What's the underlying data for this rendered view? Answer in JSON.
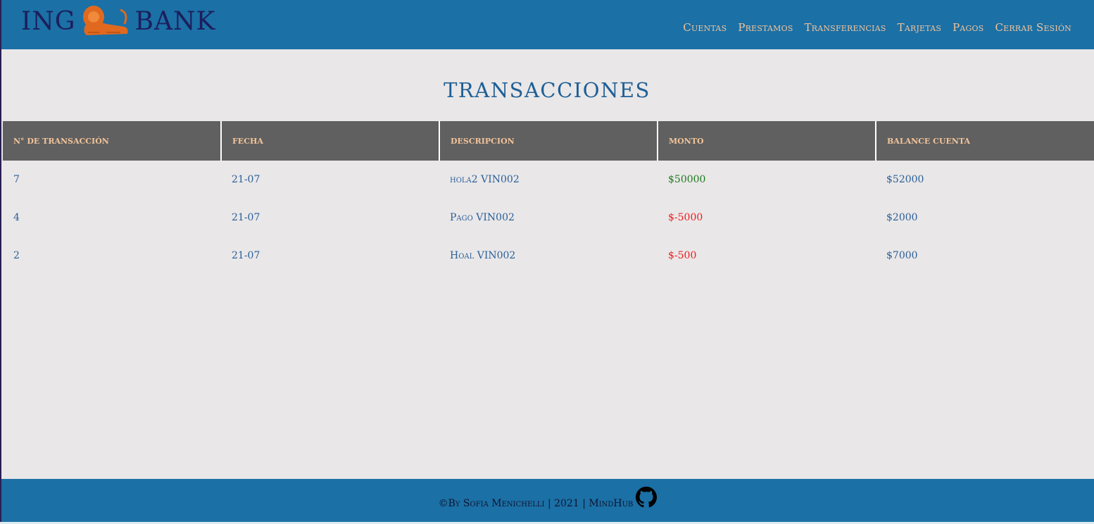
{
  "header": {
    "logo_left": "ING",
    "logo_right": "BANK",
    "nav": [
      {
        "label": "Cuentas"
      },
      {
        "label": "Prestamos"
      },
      {
        "label": "Transferencias"
      },
      {
        "label": "Tarjetas"
      },
      {
        "label": "Pagos"
      },
      {
        "label": "Cerrar Sesión"
      }
    ]
  },
  "page_title": "TRANSACCIONES",
  "table": {
    "columns": [
      "N° de transacción",
      "Fecha",
      "Descripcion",
      "Monto",
      "Balance cuenta"
    ],
    "rows": [
      {
        "id": "7",
        "date": "21-07",
        "description": "hola2 VIN002",
        "amount": "$50000",
        "balance": "$52000"
      },
      {
        "id": "4",
        "date": "21-07",
        "description": "Pago VIN002",
        "amount": "$-5000",
        "balance": "$2000"
      },
      {
        "id": "2",
        "date": "21-07",
        "description": "Hoal VIN002",
        "amount": "$-500",
        "balance": "$7000"
      }
    ]
  },
  "footer": {
    "text": "©By Sofia Menichelli | 2021 | MindHub",
    "icon": "github-icon"
  },
  "colors": {
    "header_bg": "#1b70a6",
    "nav_text": "#f3c49a",
    "title": "#1f5f95",
    "positive_amount": "#1e7a1e",
    "negative_amount": "#ee1c1c",
    "table_header_bg": "#606060"
  }
}
